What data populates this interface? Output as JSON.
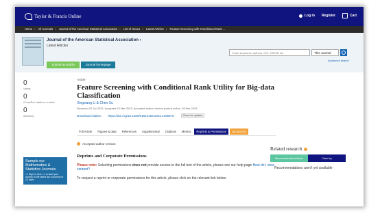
{
  "header": {
    "brand": "Taylor & Francis Online",
    "login": "Log in",
    "register": "Register",
    "cart": "Cart"
  },
  "breadcrumb": [
    "Home",
    "All Journals",
    "Journal of the American Statistical Association",
    "List of Issues",
    "Latest Articles",
    "Feature Screening with Conditional Rank ..."
  ],
  "journal": {
    "name": "Journal of the American Statistical Association ›",
    "sub": "Latest Articles",
    "submit_label": "Submit an article",
    "homepage_label": "Journal homepage"
  },
  "search": {
    "placeholder": "Enter keywords, authors, DOI, ORCID etc",
    "scope": "This Journal",
    "advanced": "Advanced search"
  },
  "metrics": [
    {
      "value": "0",
      "label": "Views"
    },
    {
      "value": "0",
      "label": "CrossRef citations to date"
    },
    {
      "value": "0",
      "label": "Altmetric"
    }
  ],
  "article": {
    "type": "Article",
    "title": "Feature Screening with Conditional Rank Utility for Big-data Classification",
    "authors": "Xingxiang Li & Chen Xu",
    "dates": "Received 20 Jul 2022, Accepted 15 Mar 2023, Accepted author version posted online: 28 Mar 2023",
    "download": "Download citation",
    "doi": "https://doi.org/10.1080/01621459.2023.2195976",
    "updates": "Check for updates"
  },
  "tabs": [
    "Full Article",
    "Figures & data",
    "References",
    "Supplemental",
    "Citations",
    "Metrics",
    "Reprints & Permissions",
    "Get access"
  ],
  "promo": {
    "headline": "Sample our Mathematics & Statistics Journals",
    "sub": ">> Sign in here << to start your access to the latest two volumes for 14 days"
  },
  "content": {
    "accepted": "Accepted author version",
    "heading": "Reprints and Corporate Permissions",
    "note_label": "Please note:",
    "note_text_a": " Selecting permissions ",
    "note_bold": "does not",
    "note_text_b": " provide access to the full text of the article, please see our help page ",
    "note_link": "How do I view content?",
    "request": "To request a reprint or corporate permissions for this article, please click on the relevant link below:"
  },
  "related": {
    "heading": "Related research",
    "tab_recommended": "Recommended articles",
    "tab_cited": "Cited by",
    "empty": "Recommendations aren't yet available"
  }
}
